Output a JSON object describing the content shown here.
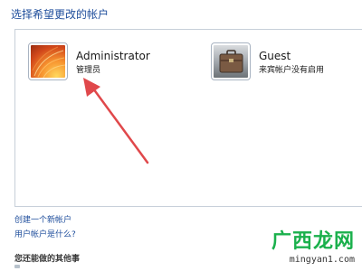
{
  "page": {
    "heading": "选择希望更改的帐户"
  },
  "accounts": [
    {
      "name": "Administrator",
      "subtitle": "管理员",
      "icon": "orange-flower-tile-icon"
    },
    {
      "name": "Guest",
      "subtitle": "来宾帐户没有启用",
      "icon": "briefcase-tile-icon"
    }
  ],
  "links": {
    "create_account": "创建一个新帐户",
    "what_is_account": "用户帐户是什么?"
  },
  "other": {
    "heading": "您还能做的其他事"
  },
  "watermark": {
    "main": "广西龙网",
    "url": "mingyan1.com"
  },
  "colors": {
    "link": "#1f4e9c",
    "arrow": "#e0484b",
    "watermark": "#1ab04c"
  }
}
